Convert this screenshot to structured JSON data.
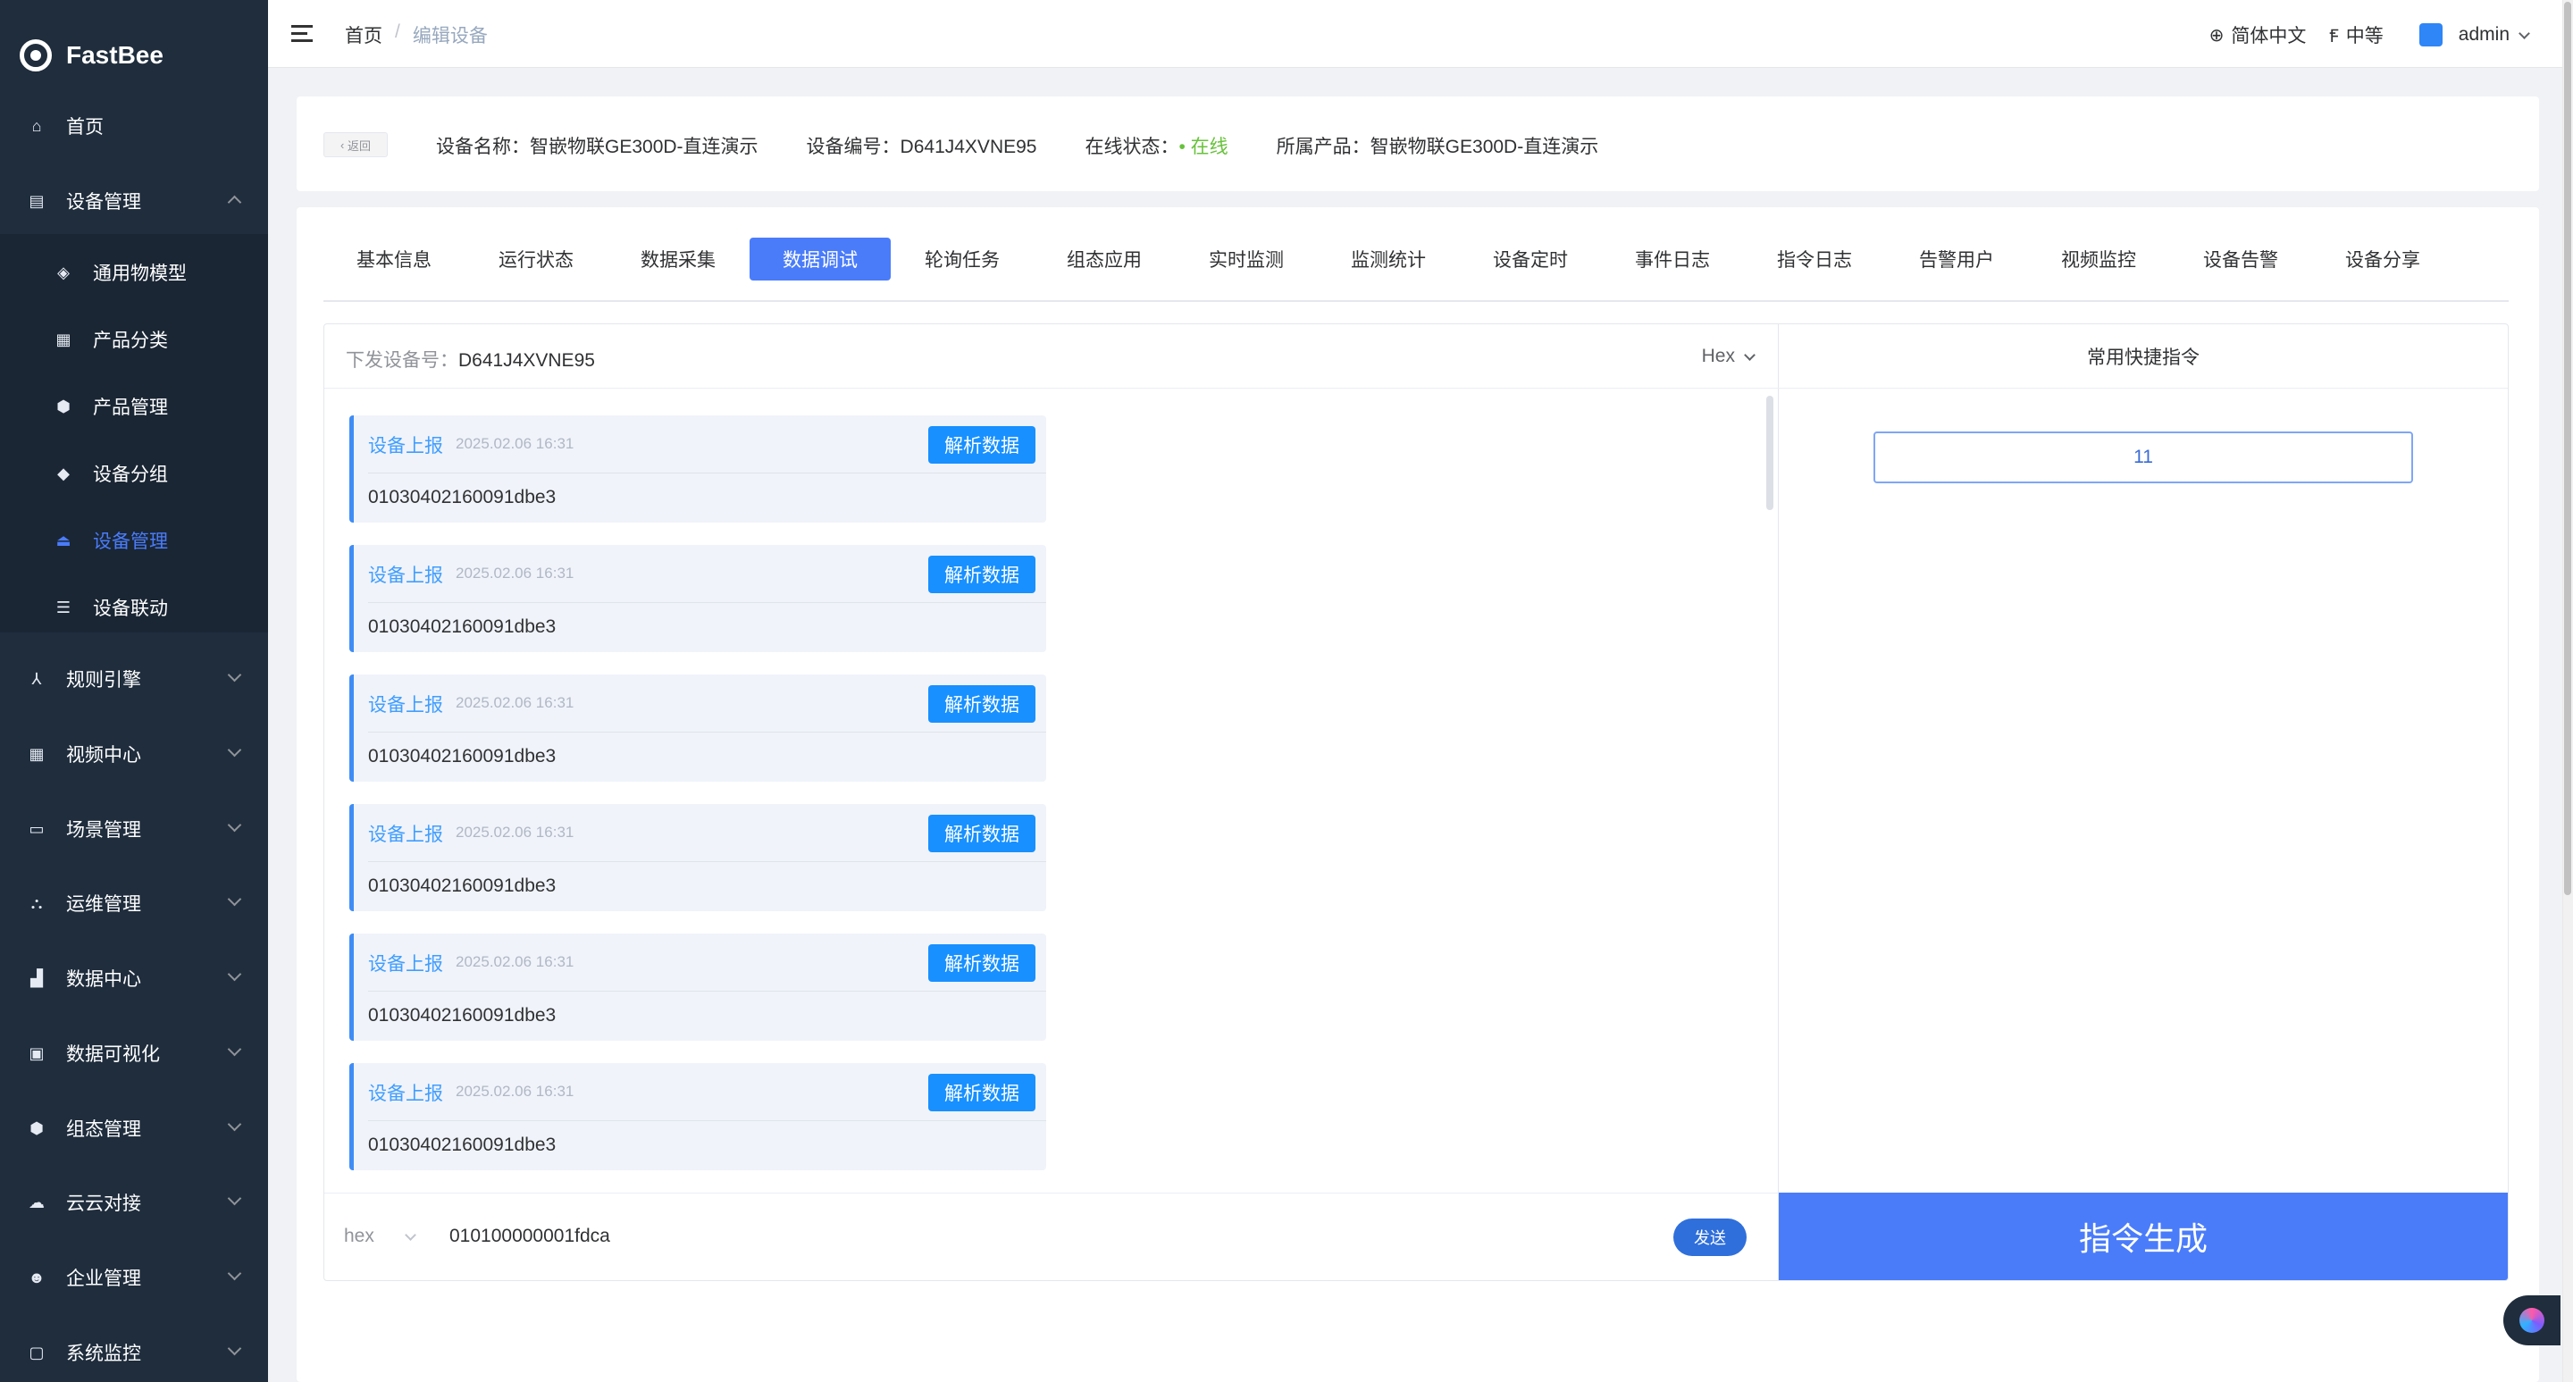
{
  "app": {
    "name": "FastBee"
  },
  "sidebar": {
    "items": [
      {
        "label": "首页",
        "icon": "home-icon"
      },
      {
        "label": "设备管理",
        "icon": "device-icon",
        "expanded": true
      },
      {
        "label": "通用物模型",
        "icon": "model-icon"
      },
      {
        "label": "产品分类",
        "icon": "category-icon"
      },
      {
        "label": "产品管理",
        "icon": "product-icon"
      },
      {
        "label": "设备分组",
        "icon": "group-icon"
      },
      {
        "label": "设备管理",
        "icon": "device-manage-icon",
        "active": true
      },
      {
        "label": "设备联动",
        "icon": "linkage-icon"
      },
      {
        "label": "规则引擎",
        "icon": "rule-icon"
      },
      {
        "label": "视频中心",
        "icon": "video-icon"
      },
      {
        "label": "场景管理",
        "icon": "scene-icon"
      },
      {
        "label": "运维管理",
        "icon": "ops-icon"
      },
      {
        "label": "数据中心",
        "icon": "data-icon"
      },
      {
        "label": "数据可视化",
        "icon": "visual-icon"
      },
      {
        "label": "组态管理",
        "icon": "config-icon"
      },
      {
        "label": "云云对接",
        "icon": "cloud-icon"
      },
      {
        "label": "企业管理",
        "icon": "enterprise-icon"
      },
      {
        "label": "系统监控",
        "icon": "monitor-icon"
      }
    ]
  },
  "header": {
    "breadcrumb": {
      "home": "首页",
      "sep": "/",
      "current": "编辑设备"
    },
    "language": "简体中文",
    "size": "中等",
    "user": "admin"
  },
  "device_info": {
    "back": "返回",
    "name_label": "设备名称：",
    "name": "智嵌物联GE300D-直连演示",
    "serial_label": "设备编号：",
    "serial": "D641J4XVNE95",
    "status_label": "在线状态：",
    "status": "在线",
    "product_label": "所属产品：",
    "product": "智嵌物联GE300D-直连演示",
    "status_color": "#67c23a"
  },
  "tabs": [
    "基本信息",
    "运行状态",
    "数据采集",
    "数据调试",
    "轮询任务",
    "组态应用",
    "实时监测",
    "监测统计",
    "设备定时",
    "事件日志",
    "指令日志",
    "告警用户",
    "视频监控",
    "设备告警",
    "设备分享"
  ],
  "active_tab": "数据调试",
  "debug": {
    "target_label": "下发设备号：",
    "target": "D641J4XVNE95",
    "format": "Hex",
    "messages": [
      {
        "source": "设备上报",
        "time": "2025.02.06 16:31",
        "action": "解析数据",
        "payload": "01030402160091dbe3"
      },
      {
        "source": "设备上报",
        "time": "2025.02.06 16:31",
        "action": "解析数据",
        "payload": "01030402160091dbe3"
      },
      {
        "source": "设备上报",
        "time": "2025.02.06 16:31",
        "action": "解析数据",
        "payload": "01030402160091dbe3"
      },
      {
        "source": "设备上报",
        "time": "2025.02.06 16:31",
        "action": "解析数据",
        "payload": "01030402160091dbe3"
      },
      {
        "source": "设备上报",
        "time": "2025.02.06 16:31",
        "action": "解析数据",
        "payload": "01030402160091dbe3"
      },
      {
        "source": "设备上报",
        "time": "2025.02.06 16:31",
        "action": "解析数据",
        "payload": "01030402160091dbe3"
      }
    ],
    "send_mode": "hex",
    "command": "010100000001fdca",
    "send_label": "发送"
  },
  "quick": {
    "title": "常用快捷指令",
    "buttons": [
      "11"
    ],
    "generate_label": "指令生成"
  },
  "colors": {
    "accent": "#4a7cfa",
    "sidebar": "#1f2d3d",
    "link": "#409eff"
  }
}
